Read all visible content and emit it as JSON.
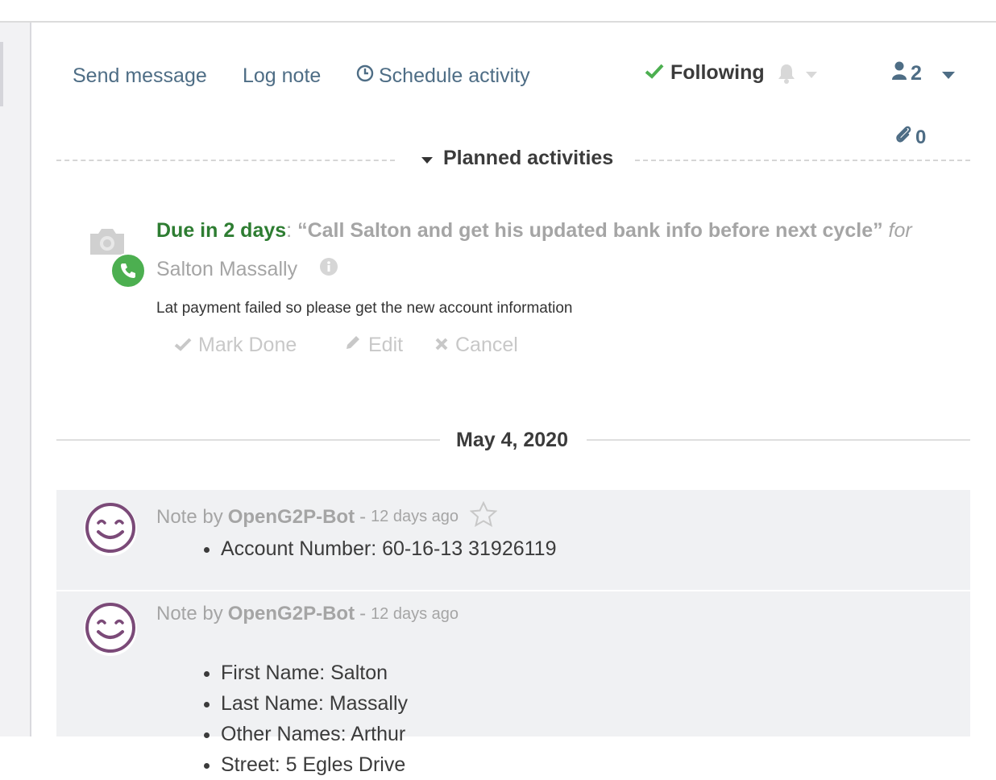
{
  "topbar": {
    "send_message": "Send message",
    "log_note": "Log note",
    "schedule_activity": "Schedule activity",
    "following": "Following",
    "followers_count": "2",
    "attachments_count": "0"
  },
  "planned": {
    "title": "Planned activities"
  },
  "activity": {
    "due": "Due in 2 days",
    "summary": "“Call Salton and get his updated bank info before next cycle”",
    "for_label": "for",
    "assignee": "Salton Massally",
    "note": "Lat payment failed so please get the new account information",
    "mark_done": "Mark Done",
    "edit": "Edit",
    "cancel": "Cancel"
  },
  "date_separator": "May 4, 2020",
  "messages": [
    {
      "prefix": "Note by",
      "author": "OpenG2P-Bot",
      "dash": "-",
      "date": "12 days ago",
      "items": [
        "Account Number: 60-16-13 31926119"
      ]
    },
    {
      "prefix": "Note by",
      "author": "OpenG2P-Bot",
      "dash": "-",
      "date": "12 days ago",
      "items": [
        "First Name: Salton",
        "Last Name: Massally",
        "Other Names: Arthur",
        "Street: 5 Egles Drive"
      ]
    }
  ],
  "colors": {
    "link": "#4e6d85",
    "due_green": "#2e7d32",
    "phone_badge": "#4caf50",
    "avatar_purple": "#7b4a78",
    "message_bg": "#f0f1f3"
  },
  "icons": [
    "clock-icon",
    "check-icon",
    "bell-icon",
    "caret-down-icon",
    "user-icon",
    "paperclip-icon",
    "camera-icon",
    "phone-icon",
    "info-icon",
    "pencil-icon",
    "times-icon",
    "star-icon",
    "smiley-avatar-icon"
  ]
}
